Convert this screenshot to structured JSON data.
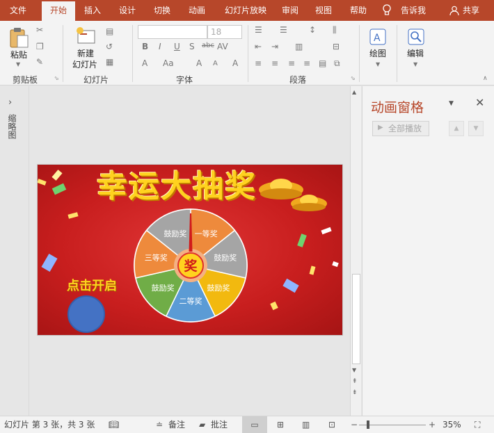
{
  "tabs": [
    "文件",
    "开始",
    "插入",
    "设计",
    "切换",
    "动画",
    "幻灯片放映",
    "审阅",
    "视图",
    "帮助",
    "告诉我",
    "共享"
  ],
  "ribbon": {
    "clipboard": {
      "paste_label": "粘贴",
      "group_label": "剪贴板"
    },
    "slides": {
      "new_slide_line1": "新建",
      "new_slide_line2": "幻灯片",
      "group_label": "幻灯片"
    },
    "font": {
      "font_name": "",
      "font_size": "18",
      "group_label": "字体",
      "buttons": [
        "B",
        "I",
        "U",
        "S",
        "abc",
        "AV",
        "A",
        "Aa",
        "A",
        "A",
        "A"
      ]
    },
    "paragraph": {
      "group_label": "段落"
    },
    "drawing": {
      "label": "绘图"
    },
    "editing": {
      "label": "编辑"
    }
  },
  "left_pane": {
    "label": "缩略图"
  },
  "slide": {
    "title": "幸运大抽奖",
    "start_text": "点击开启",
    "center_text": "奖",
    "wheel_segments": [
      {
        "label": "一等奖",
        "color": "#ee8a3c"
      },
      {
        "label": "鼓励奖",
        "color": "#a5a5a5"
      },
      {
        "label": "鼓励奖",
        "color": "#f2b90f"
      },
      {
        "label": "二等奖",
        "color": "#5b9bd5"
      },
      {
        "label": "鼓励奖",
        "color": "#70ad47"
      },
      {
        "label": "三等奖",
        "color": "#ee8a3c"
      },
      {
        "label": "鼓励奖",
        "color": "#a5a5a5"
      }
    ]
  },
  "animation_pane": {
    "title": "动画窗格",
    "play_all": "全部播放"
  },
  "status": {
    "slide_info": "幻灯片 第 3 张，共 3 张",
    "notes": "备注",
    "comments": "批注",
    "zoom": "35%"
  },
  "colors": {
    "accent": "#b7472a",
    "slide_red": "#c81e1e",
    "title_yellow": "#ffd21f"
  }
}
